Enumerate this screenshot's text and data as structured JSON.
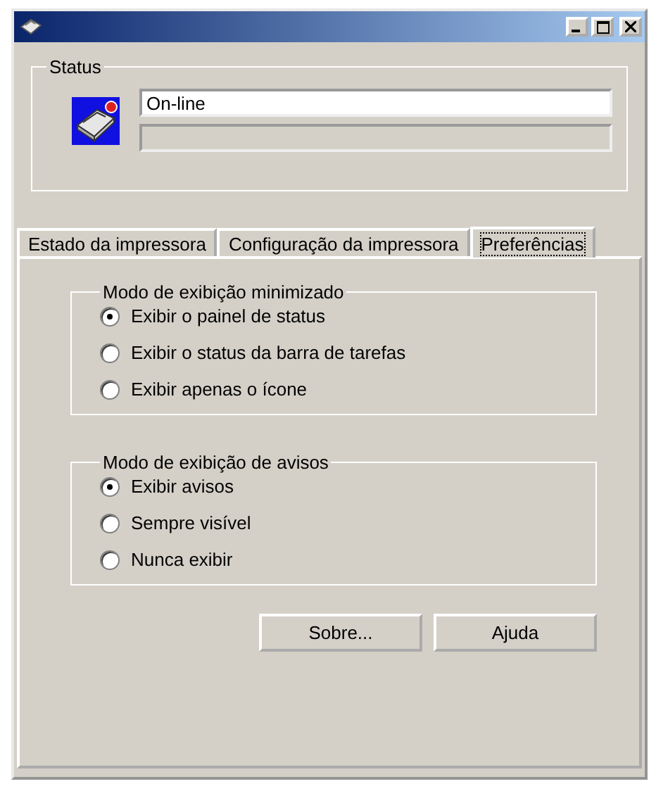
{
  "window": {
    "controls": [
      {
        "kind": "minimize"
      },
      {
        "kind": "maximize"
      },
      {
        "kind": "close"
      }
    ]
  },
  "status": {
    "title": "Status",
    "value": "On-line"
  },
  "tabs": [
    {
      "label": "Estado da impressora",
      "selected": false
    },
    {
      "label": "Configuração da impressora",
      "selected": false
    },
    {
      "label": "Preferências",
      "selected": true
    }
  ],
  "groups": [
    {
      "title": "Modo de exibição minimizado",
      "options": [
        {
          "label": "Exibir o painel de status",
          "selected": true
        },
        {
          "label": "Exibir o status da barra de tarefas",
          "selected": false
        },
        {
          "label": "Exibir apenas o ícone",
          "selected": false
        }
      ]
    },
    {
      "title": "Modo de exibição de avisos",
      "options": [
        {
          "label": "Exibir avisos",
          "selected": true
        },
        {
          "label": "Sempre visível",
          "selected": false
        },
        {
          "label": "Nunca exibir",
          "selected": false
        }
      ]
    }
  ],
  "buttons": [
    "Sobre...",
    "Ajuda"
  ]
}
